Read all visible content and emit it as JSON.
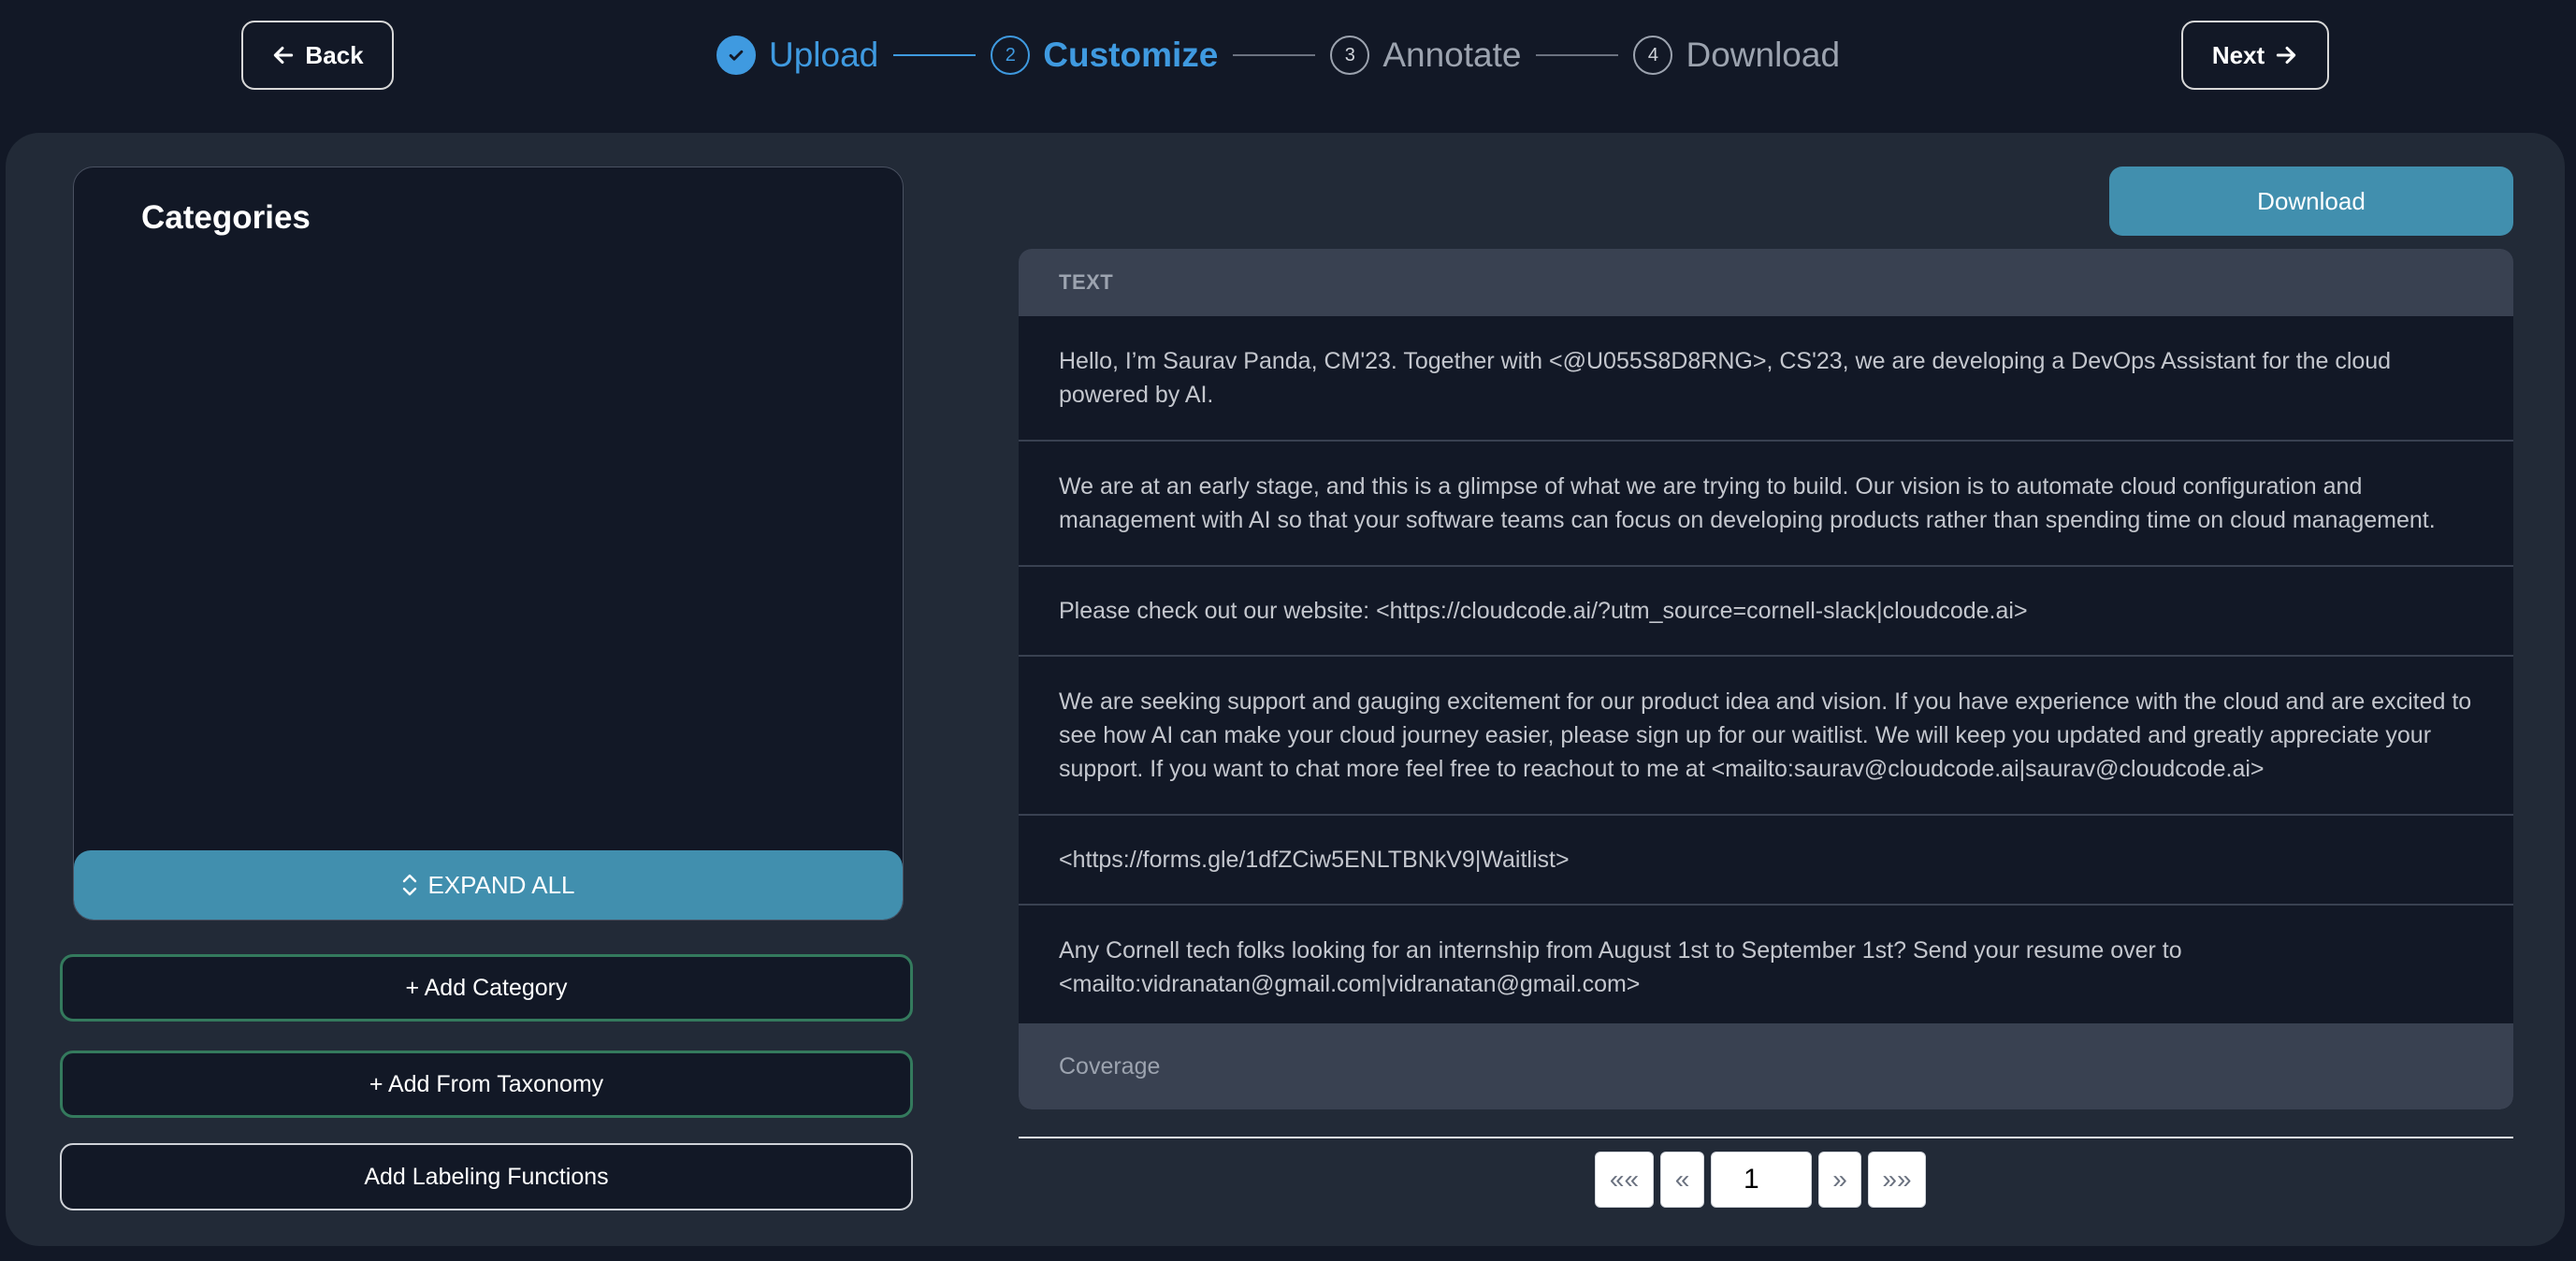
{
  "nav": {
    "back_label": "Back",
    "next_label": "Next"
  },
  "stepper": {
    "steps": [
      {
        "number": "1",
        "label": "Upload",
        "state": "done"
      },
      {
        "number": "2",
        "label": "Customize",
        "state": "active"
      },
      {
        "number": "3",
        "label": "Annotate",
        "state": "pending"
      },
      {
        "number": "4",
        "label": "Download",
        "state": "pending"
      }
    ]
  },
  "sidebar": {
    "title": "Categories",
    "expand_all_label": "EXPAND ALL",
    "add_category_label": "+ Add Category",
    "add_from_taxonomy_label": "+ Add From Taxonomy",
    "add_labeling_functions_label": "Add Labeling Functions"
  },
  "main": {
    "download_label": "Download",
    "table": {
      "column_header": "TEXT",
      "rows": [
        "Hello, I’m Saurav Panda, CM'23. Together with <@U055S8D8RNG>, CS'23, we are developing a DevOps Assistant for the cloud powered by AI.",
        "We are at an early stage, and this is a glimpse of what we are trying to build. Our vision is to automate cloud configuration and management with AI so that your software teams can focus on developing products rather than spending time on cloud management.",
        "Please check out our website: <https://cloudcode.ai/?utm_source=cornell-slack|cloudcode.ai>",
        "We are seeking support and gauging excitement for our product idea and vision. If you have experience with the cloud and are excited to see how AI can make your cloud journey easier, please sign up for our waitlist. We will keep you updated and greatly appreciate your support. If you want to chat more feel free to reachout to me at <mailto:saurav@cloudcode.ai|saurav@cloudcode.ai>",
        "<https://forms.gle/1dfZCiw5ENLTBNkV9|Waitlist>",
        "Any Cornell tech folks looking for an internship from August 1st to September 1st? Send your resume over to <mailto:vidranatan@gmail.com|vidranatan@gmail.com>"
      ],
      "footer_label": "Coverage"
    },
    "pagination": {
      "first_label": "««",
      "prev_label": "«",
      "current_page": "1",
      "next_label": "»",
      "last_label": "»»"
    }
  },
  "colors": {
    "accent_blue": "#3f9ae0",
    "button_teal": "#418fae",
    "green_border": "#347a5d",
    "background": "#121826",
    "panel": "#222a37"
  }
}
